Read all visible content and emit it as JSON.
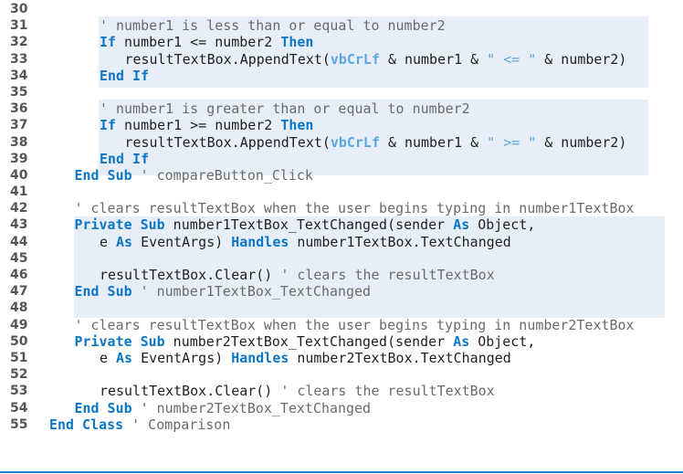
{
  "listing": {
    "highlight_color": "#e7eef8",
    "keyword_color": "#0b76c5",
    "constant_color": "#5aa6dd",
    "comment_color": "#6a6a6a",
    "rule_color": "#1b7ec8",
    "lines": [
      {
        "num": "30",
        "indent": 0,
        "tokens": []
      },
      {
        "num": "31",
        "indent": 2,
        "tokens": [
          {
            "t": "cm",
            "v": "' number1 is less than or equal to number2"
          }
        ]
      },
      {
        "num": "32",
        "indent": 2,
        "tokens": [
          {
            "t": "kw",
            "v": "If"
          },
          {
            "t": "id",
            "v": " number1 <= number2 "
          },
          {
            "t": "kw",
            "v": "Then"
          }
        ]
      },
      {
        "num": "33",
        "indent": 3,
        "tokens": [
          {
            "t": "id",
            "v": "resultTextBox.AppendText("
          },
          {
            "t": "cn",
            "v": "vbCrLf"
          },
          {
            "t": "id",
            "v": " & number1 & "
          },
          {
            "t": "st",
            "v": "\" <= \""
          },
          {
            "t": "id",
            "v": " & number2)"
          }
        ]
      },
      {
        "num": "34",
        "indent": 2,
        "tokens": [
          {
            "t": "kw",
            "v": "End If"
          }
        ]
      },
      {
        "num": "35",
        "indent": 0,
        "tokens": []
      },
      {
        "num": "36",
        "indent": 2,
        "tokens": [
          {
            "t": "cm",
            "v": "' number1 is greater than or equal to number2"
          }
        ]
      },
      {
        "num": "37",
        "indent": 2,
        "tokens": [
          {
            "t": "kw",
            "v": "If"
          },
          {
            "t": "id",
            "v": " number1 >= number2 "
          },
          {
            "t": "kw",
            "v": "Then"
          }
        ]
      },
      {
        "num": "38",
        "indent": 3,
        "tokens": [
          {
            "t": "id",
            "v": "resultTextBox.AppendText("
          },
          {
            "t": "cn",
            "v": "vbCrLf"
          },
          {
            "t": "id",
            "v": " & number1 & "
          },
          {
            "t": "st",
            "v": "\" >= \""
          },
          {
            "t": "id",
            "v": " & number2)"
          }
        ]
      },
      {
        "num": "39",
        "indent": 2,
        "tokens": [
          {
            "t": "kw",
            "v": "End If"
          }
        ]
      },
      {
        "num": "40",
        "indent": 1,
        "tokens": [
          {
            "t": "kw",
            "v": "End Sub"
          },
          {
            "t": "cm",
            "v": " ' compareButton_Click"
          }
        ]
      },
      {
        "num": "41",
        "indent": 0,
        "tokens": []
      },
      {
        "num": "42",
        "indent": 1,
        "tokens": [
          {
            "t": "cm",
            "v": "' clears resultTextBox when the user begins typing in number1TextBox"
          }
        ]
      },
      {
        "num": "43",
        "indent": 1,
        "tokens": [
          {
            "t": "kw",
            "v": "Private Sub"
          },
          {
            "t": "id",
            "v": " number1TextBox_TextChanged(sender "
          },
          {
            "t": "kw",
            "v": "As"
          },
          {
            "t": "id",
            "v": " Object,"
          }
        ]
      },
      {
        "num": "44",
        "indent": 2,
        "tokens": [
          {
            "t": "id",
            "v": "e "
          },
          {
            "t": "kw",
            "v": "As"
          },
          {
            "t": "id",
            "v": " EventArgs) "
          },
          {
            "t": "kw",
            "v": "Handles"
          },
          {
            "t": "id",
            "v": " number1TextBox.TextChanged"
          }
        ]
      },
      {
        "num": "45",
        "indent": 0,
        "tokens": []
      },
      {
        "num": "46",
        "indent": 2,
        "tokens": [
          {
            "t": "id",
            "v": "resultTextBox.Clear() "
          },
          {
            "t": "cm",
            "v": "' clears the resultTextBox"
          }
        ]
      },
      {
        "num": "47",
        "indent": 1,
        "tokens": [
          {
            "t": "kw",
            "v": "End Sub"
          },
          {
            "t": "cm",
            "v": " ' number1TextBox_TextChanged"
          }
        ]
      },
      {
        "num": "48",
        "indent": 0,
        "tokens": []
      },
      {
        "num": "49",
        "indent": 1,
        "tokens": [
          {
            "t": "cm",
            "v": "' clears resultTextBox when the user begins typing in number2TextBox"
          }
        ]
      },
      {
        "num": "50",
        "indent": 1,
        "tokens": [
          {
            "t": "kw",
            "v": "Private Sub"
          },
          {
            "t": "id",
            "v": " number2TextBox_TextChanged(sender "
          },
          {
            "t": "kw",
            "v": "As"
          },
          {
            "t": "id",
            "v": " Object,"
          }
        ]
      },
      {
        "num": "51",
        "indent": 2,
        "tokens": [
          {
            "t": "id",
            "v": "e "
          },
          {
            "t": "kw",
            "v": "As"
          },
          {
            "t": "id",
            "v": " EventArgs) "
          },
          {
            "t": "kw",
            "v": "Handles"
          },
          {
            "t": "id",
            "v": " number2TextBox.TextChanged"
          }
        ]
      },
      {
        "num": "52",
        "indent": 0,
        "tokens": []
      },
      {
        "num": "53",
        "indent": 2,
        "tokens": [
          {
            "t": "id",
            "v": "resultTextBox.Clear() "
          },
          {
            "t": "cm",
            "v": "' clears the resultTextBox"
          }
        ]
      },
      {
        "num": "54",
        "indent": 1,
        "tokens": [
          {
            "t": "kw",
            "v": "End Sub"
          },
          {
            "t": "cm",
            "v": " ' number2TextBox_TextChanged"
          }
        ]
      },
      {
        "num": "55",
        "indent": 0,
        "tokens": [
          {
            "t": "kw",
            "v": "End Class"
          },
          {
            "t": "cm",
            "v": " ' Comparison"
          }
        ]
      }
    ]
  }
}
